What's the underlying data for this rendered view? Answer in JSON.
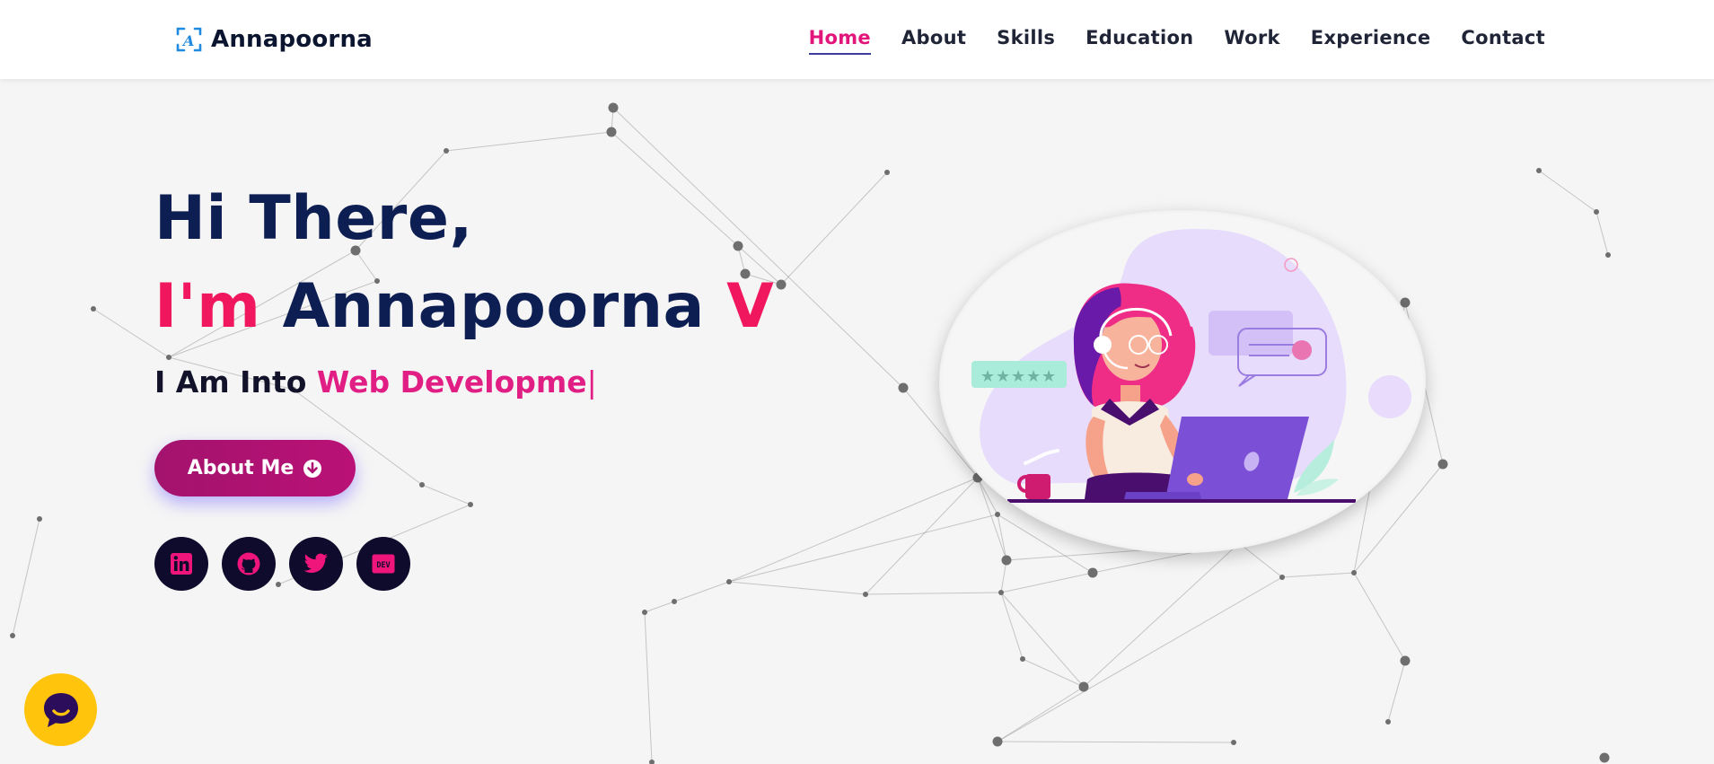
{
  "brand": {
    "name": "Annapoorna",
    "logo_icon": "ai-logo-icon",
    "accent": "#1f8ae0"
  },
  "nav": {
    "items": [
      {
        "label": "Home",
        "active": true
      },
      {
        "label": "About",
        "active": false
      },
      {
        "label": "Skills",
        "active": false
      },
      {
        "label": "Education",
        "active": false
      },
      {
        "label": "Work",
        "active": false
      },
      {
        "label": "Experience",
        "active": false
      },
      {
        "label": "Contact",
        "active": false
      }
    ],
    "active_color": "#e2157a"
  },
  "hero": {
    "greeting": "Hi There,",
    "intro_prefix": "I'm",
    "name": "Annapoorna",
    "initial": "V",
    "typing_prefix": "I Am Into",
    "typing_text": "Web Developme",
    "cursor": "|",
    "button_label": "About Me",
    "button_icon": "arrow-down-circle-icon",
    "illustration": "woman-working-on-laptop-illustration"
  },
  "socials": [
    {
      "name": "linkedin",
      "icon": "linkedin-icon"
    },
    {
      "name": "github",
      "icon": "github-icon"
    },
    {
      "name": "twitter",
      "icon": "twitter-icon"
    },
    {
      "name": "dev",
      "icon": "dev-icon",
      "label": "DEV"
    }
  ],
  "chat_widget": {
    "icon": "chat-bubble-icon"
  },
  "colors": {
    "heading": "#0d1e52",
    "pink": "#f1175f",
    "magenta": "#e01e84",
    "button": "#a3136d",
    "social_bg": "#0e0b2c",
    "chat": "#ffc40b",
    "background": "#f5f5f5"
  }
}
